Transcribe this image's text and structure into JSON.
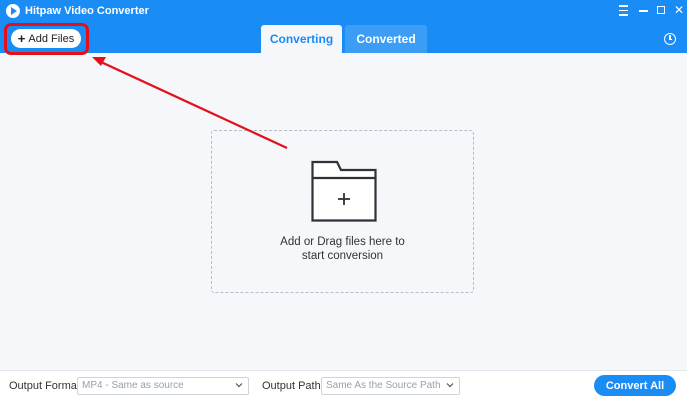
{
  "app": {
    "title": "Hitpaw Video Converter"
  },
  "toolbar": {
    "add_files_label": "Add Files"
  },
  "tabs": [
    {
      "label": "Converting",
      "active": true
    },
    {
      "label": "Converted",
      "active": false
    }
  ],
  "dropzone": {
    "text": "Add or Drag files here to start conversion"
  },
  "bottom": {
    "output_format_label": "Output Format:",
    "output_format_value": "MP4 - Same as source",
    "output_path_label": "Output Path:",
    "output_path_value": "Same As the Source Path",
    "convert_all_label": "Convert All"
  },
  "colors": {
    "accent": "#1a8cf5",
    "annotation": "#e3101b"
  },
  "icons": [
    "app-logo-icon",
    "menu-icon",
    "minimize-icon",
    "maximize-icon",
    "close-icon",
    "history-icon",
    "plus-icon",
    "folder-add-icon",
    "chevron-down-icon"
  ]
}
